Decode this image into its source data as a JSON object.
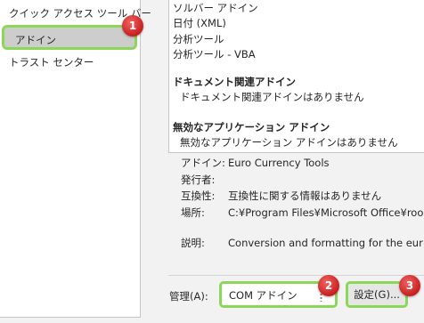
{
  "sidebar": {
    "items": [
      {
        "label": "クイック アクセス ツール バー"
      },
      {
        "label": "アドイン"
      },
      {
        "label": "トラスト センター"
      }
    ]
  },
  "addin_list": {
    "rows": [
      "ソルバー アドイン",
      "日付 (XML)",
      "分析ツール",
      "分析ツール - VBA"
    ],
    "doc_group": {
      "title": "ドキュメント関連アドイン",
      "empty": "ドキュメント関連アドインはありません"
    },
    "disabled_group": {
      "title": "無効なアプリケーション アドイン",
      "empty": "無効なアプリケーション アドインはありません"
    }
  },
  "details": {
    "addin_label": "アドイン:",
    "addin_value": "Euro Currency Tools",
    "publisher_label": "発行者:",
    "publisher_value": "",
    "compat_label": "互換性:",
    "compat_value": "互換性に関する情報はありません",
    "location_label": "場所:",
    "location_value": "C:¥Program Files¥Microsoft Office¥roo",
    "desc_label": "説明:",
    "desc_value": "Conversion and formatting for the eur"
  },
  "manage": {
    "label": "管理(A):",
    "selected": "COM アドイン",
    "go_label": "設定(G)..."
  },
  "badges": [
    "1",
    "2",
    "3"
  ],
  "colors": {
    "highlight": "#8cd65a",
    "badge": "#d42a2a"
  }
}
